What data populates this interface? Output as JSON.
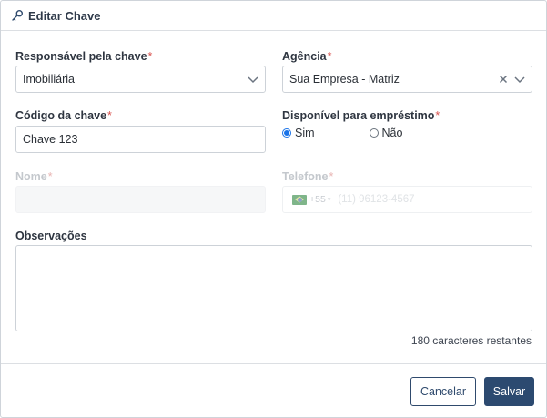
{
  "dialog": {
    "title": "Editar Chave",
    "icon": "key-icon"
  },
  "form": {
    "responsavel": {
      "label": "Responsável pela chave",
      "required": "*",
      "value": "Imobiliária"
    },
    "agencia": {
      "label": "Agência",
      "required": "*",
      "value": "Sua Empresa - Matriz"
    },
    "codigo": {
      "label": "Código da chave",
      "required": "*",
      "value": "Chave 123"
    },
    "disponivel": {
      "label": "Disponível para empréstimo",
      "required": "*",
      "options": [
        "Sim",
        "Não"
      ],
      "selected": "Sim"
    },
    "nome": {
      "label": "Nome",
      "required": "*",
      "value": ""
    },
    "telefone": {
      "label": "Telefone",
      "required": "*",
      "country_code": "+55",
      "placeholder": "(11) 96123-4567"
    },
    "observacoes": {
      "label": "Observações",
      "value": "",
      "counter": "180 caracteres restantes"
    }
  },
  "footer": {
    "cancel_label": "Cancelar",
    "save_label": "Salvar"
  },
  "colors": {
    "primary": "#2c4a70",
    "required": "#d9534f",
    "radio_selected": "#1a73e8"
  }
}
